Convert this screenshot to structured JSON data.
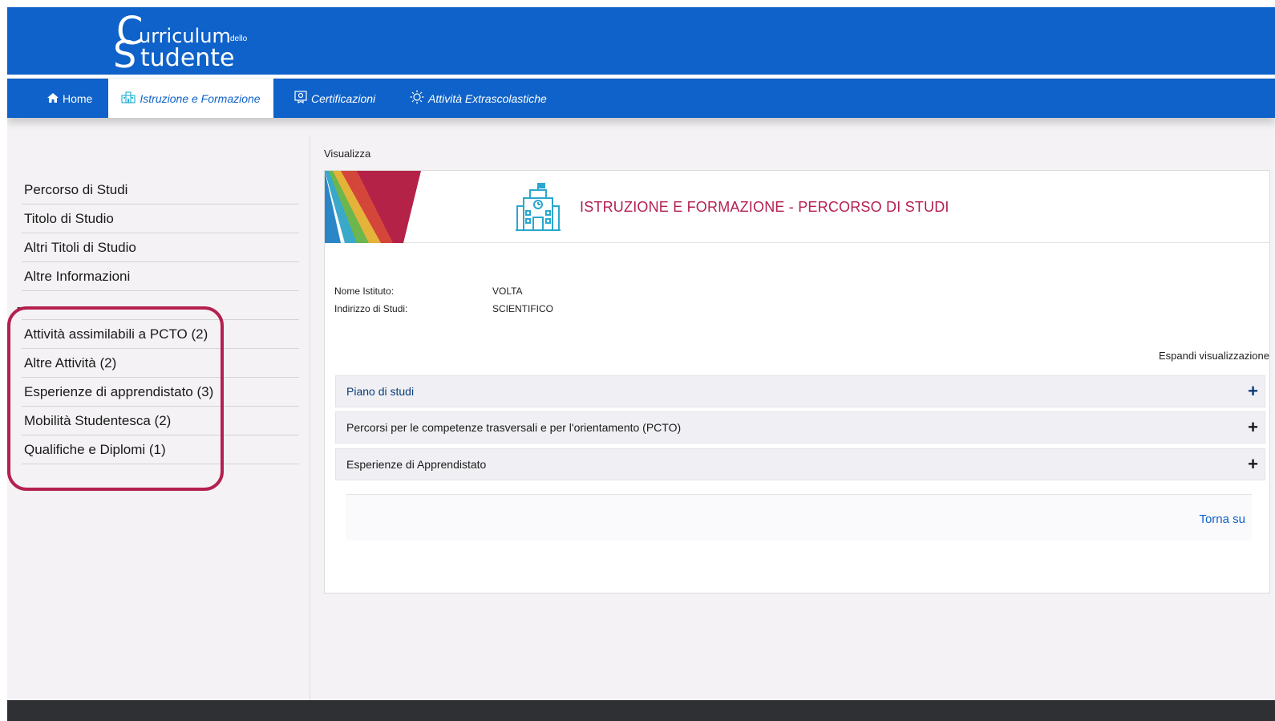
{
  "app": {
    "logo_first_line": "urriculum",
    "logo_c": "C",
    "logo_dello": "dello",
    "logo_s": "S",
    "logo_second_line": "tudente"
  },
  "nav": {
    "items": [
      {
        "label": "Home",
        "icon": "home-icon"
      },
      {
        "label": "Istruzione e Formazione",
        "icon": "school-building-icon"
      },
      {
        "label": "Certificazioni",
        "icon": "certificate-icon"
      },
      {
        "label": "Attività Extrascolastiche",
        "icon": "gear-sun-icon"
      }
    ],
    "active": "Istruzione e Formazione"
  },
  "sidebar": {
    "items": [
      {
        "label": "Percorso di Studi"
      },
      {
        "label": "Titolo di Studio"
      },
      {
        "label": "Altri Titoli di Studio"
      },
      {
        "label": "Altre Informazioni"
      }
    ],
    "separator": "------------------------------------",
    "sub_items": [
      {
        "label": "Attività assimilabili a PCTO (2)"
      },
      {
        "label": "Altre Attività (2)"
      },
      {
        "label": "Esperienze di apprendistato (3)"
      },
      {
        "label": "Mobilità Studentesca (2)"
      },
      {
        "label": "Qualifiche e Diplomi (1)"
      }
    ],
    "highlight_color": "#b4204f"
  },
  "main": {
    "breadcrumb": "Visualizza",
    "banner_title": "ISTRUZIONE E FORMAZIONE - PERCORSO DI STUDI",
    "info": [
      {
        "label": "Nome Istituto:",
        "value": "VOLTA"
      },
      {
        "label": "Indirizzo di Studi:",
        "value": "SCIENTIFICO"
      }
    ],
    "expand_label": "Espandi visualizzazione",
    "accordions": [
      {
        "label": "Piano di studi",
        "icon": "plus-icon"
      },
      {
        "label": "Percorsi per le competenze trasversali e per l'orientamento (PCTO)",
        "icon": "plus-icon"
      },
      {
        "label": "Esperienze di Apprendistato",
        "icon": "plus-icon"
      }
    ],
    "back_to_top": "Torna su"
  },
  "colors": {
    "primary": "#0f62c9",
    "accent": "#b4204f",
    "footer": "#2f3033"
  }
}
